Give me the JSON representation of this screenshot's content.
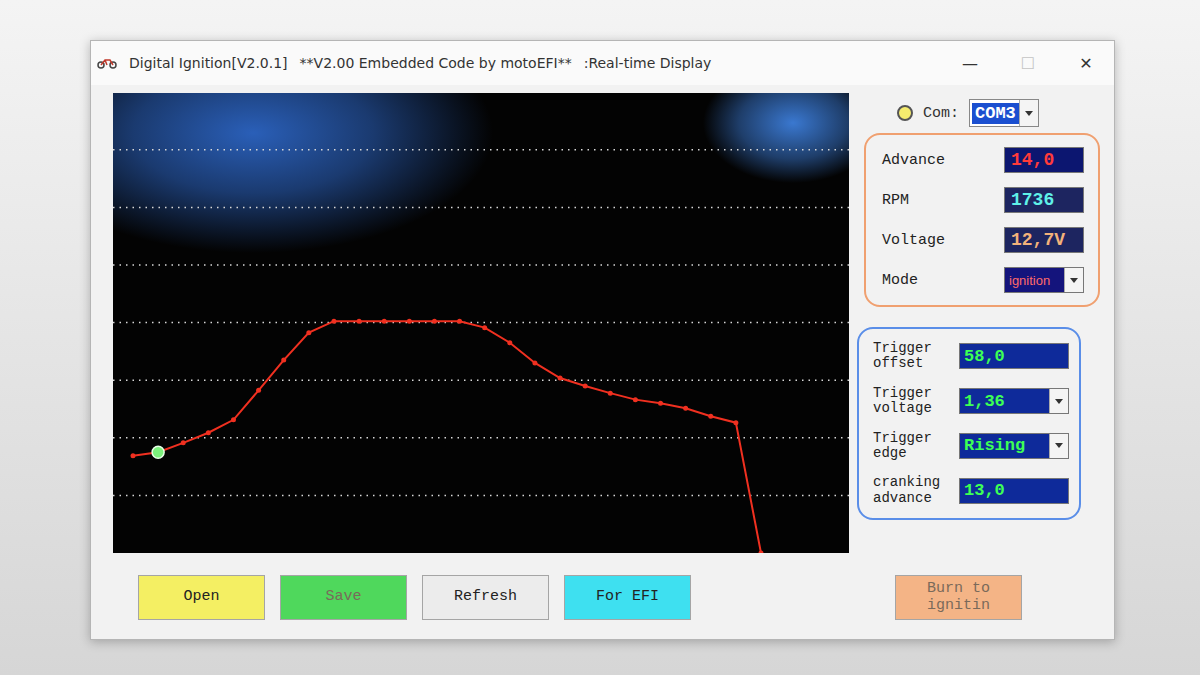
{
  "window": {
    "title": "Digital Ignition[V2.0.1]",
    "subtitle": "**V2.00 Embedded Code by motoEFI**",
    "view": ":Real-time Display",
    "controls": [
      {
        "label": "—",
        "disabled": false
      },
      {
        "label": "☐",
        "disabled": true
      },
      {
        "label": "✕",
        "disabled": false
      }
    ]
  },
  "com": {
    "label": "Com:",
    "value": "COM3",
    "connected": true
  },
  "readouts": [
    {
      "label": "Advance",
      "value": "14,0",
      "kind": "field",
      "color": "#ff3b3b"
    },
    {
      "label": "RPM",
      "value": "1736",
      "kind": "field",
      "color": "#5ff0e8"
    },
    {
      "label": "Voltage",
      "value": "12,7V",
      "kind": "field",
      "color": "#f2b27a"
    },
    {
      "label": "Mode",
      "value": "ignition",
      "kind": "dropdown",
      "color": "#ff6a6a"
    }
  ],
  "trigger": [
    {
      "label": "Trigger offset",
      "value": "58,0",
      "kind": "field"
    },
    {
      "label": "Trigger voltage",
      "value": "1,36",
      "kind": "dropdown"
    },
    {
      "label": "Trigger edge",
      "value": "Rising",
      "kind": "dropdown"
    },
    {
      "label": "cranking advance",
      "value": "13,0",
      "kind": "field"
    }
  ],
  "chart": {
    "series": [
      {
        "name": "advance",
        "values": [
          13.5,
          14.0,
          15.3,
          16.7,
          18.5,
          22.6,
          26.8,
          30.6,
          32.2,
          32.2,
          32.2,
          32.2,
          32.2,
          32.2,
          31.3,
          29.2,
          26.4,
          24.3,
          23.2,
          22.2,
          21.3,
          20.8,
          20.1,
          19.0,
          18.1,
          0
        ]
      }
    ],
    "current_index": 1
  },
  "buttons": [
    {
      "label": "Open",
      "disabled": false,
      "color": "#f4ef63"
    },
    {
      "label": "Save",
      "disabled": true,
      "color": "#4fd85c"
    },
    {
      "label": "Refresh",
      "disabled": false,
      "color": "#ececec"
    },
    {
      "label": "For EFI",
      "disabled": false,
      "color": "#3ee0f0"
    },
    {
      "label": "Burn to ignitin",
      "disabled": true,
      "color": "#f4b486"
    }
  ]
}
